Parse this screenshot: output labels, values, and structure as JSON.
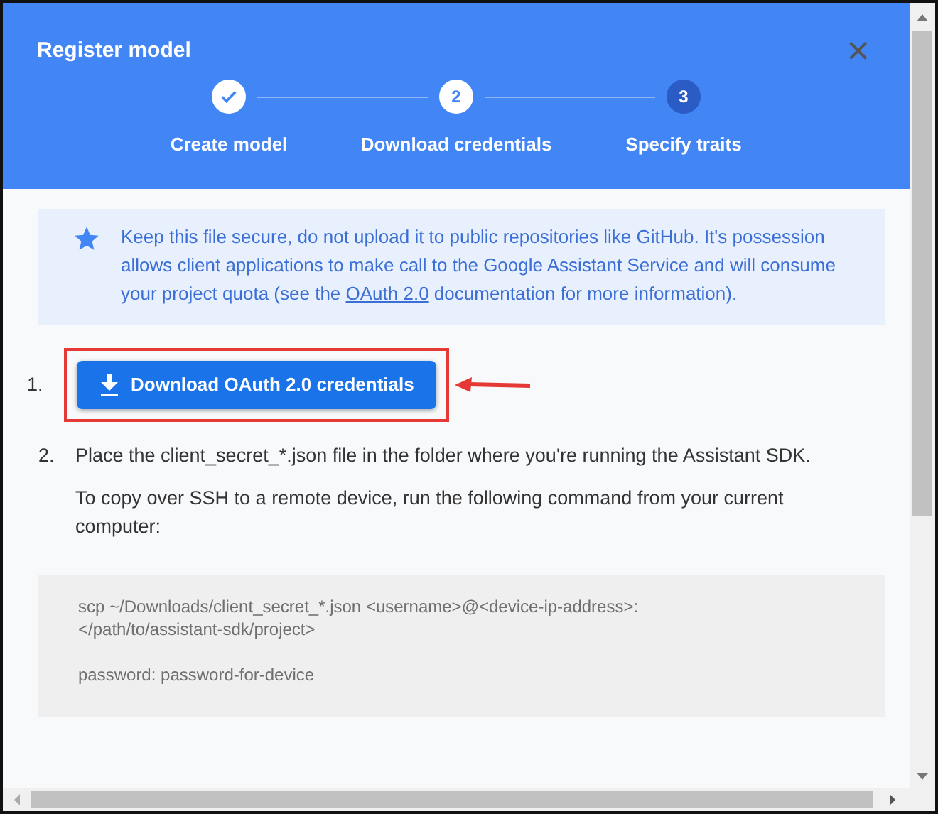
{
  "dialog": {
    "title": "Register model",
    "close_label": "×"
  },
  "steps": [
    {
      "label": "Create model",
      "completed": true,
      "highlighted": false
    },
    {
      "number": "2",
      "label": "Download credentials",
      "completed": false,
      "highlighted": false
    },
    {
      "number": "3",
      "label": "Specify traits",
      "completed": false,
      "highlighted": true
    }
  ],
  "notice": {
    "text": "Keep this file secure, do not upload it to public repositories like GitHub. It's possession allows client applications to make call to the Google Assistant Service and will consume your project quota (see the ",
    "link": "OAuth 2.0",
    "text_after": " documentation for more information)."
  },
  "items": [
    {
      "marker": "1.",
      "kind": "button",
      "button": "Download OAuth 2.0 credentials",
      "highlighted": true,
      "arrow": true
    },
    {
      "marker": "2.",
      "kind": "text",
      "paragraphs": [
        "Place the client_secret_*.json file in the folder where you're running the Assistant SDK.",
        "To copy over SSH to a remote device, run the following command from your current computer:"
      ]
    }
  ],
  "code": [
    [
      "scp ~/Downloads/client_secret_*.json <username>@<device-ip-address>:",
      "</path/to/assistant-sdk/project>"
    ],
    [
      "password: password-for-device"
    ]
  ]
}
